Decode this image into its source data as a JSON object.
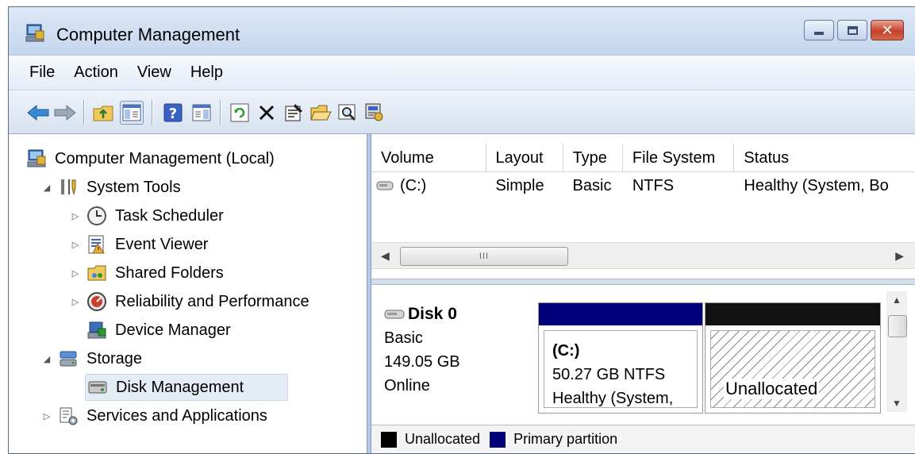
{
  "window": {
    "title": "Computer Management"
  },
  "menu": [
    "File",
    "Action",
    "View",
    "Help"
  ],
  "toolbar": {
    "icons": [
      "back-arrow-icon",
      "forward-arrow-icon",
      "up-folder-icon",
      "show-hide-tree-icon",
      "help-icon",
      "show-hide-action-pane-icon",
      "refresh-icon",
      "delete-icon",
      "properties-icon",
      "open-folder-icon",
      "search-icon",
      "settings-icon"
    ]
  },
  "tree": {
    "root": "Computer Management (Local)",
    "system_tools": "System Tools",
    "task_scheduler": "Task Scheduler",
    "event_viewer": "Event Viewer",
    "shared_folders": "Shared Folders",
    "reliability": "Reliability and Performance",
    "device_manager": "Device Manager",
    "storage": "Storage",
    "disk_management": "Disk Management",
    "services": "Services and Applications"
  },
  "volumes": {
    "headers": [
      "Volume",
      "Layout",
      "Type",
      "File System",
      "Status"
    ],
    "rows": [
      [
        "(C:)",
        "Simple",
        "Basic",
        "NTFS",
        "Healthy (System, Bo"
      ]
    ],
    "scroll_grip": "III"
  },
  "disk": {
    "name": "Disk 0",
    "type": "Basic",
    "size": "149.05 GB",
    "status": "Online",
    "partition": {
      "label": "(C:)",
      "size_fs": "50.27 GB NTFS",
      "status": "Healthy (System,"
    },
    "unallocated_label": "Unallocated"
  },
  "legend": {
    "items": [
      {
        "label": "Unallocated",
        "color": "#000000"
      },
      {
        "label": "Primary partition",
        "color": "#00007b"
      }
    ]
  },
  "colors": {
    "primary_partition": "#00007b",
    "unallocated": "#111111"
  }
}
